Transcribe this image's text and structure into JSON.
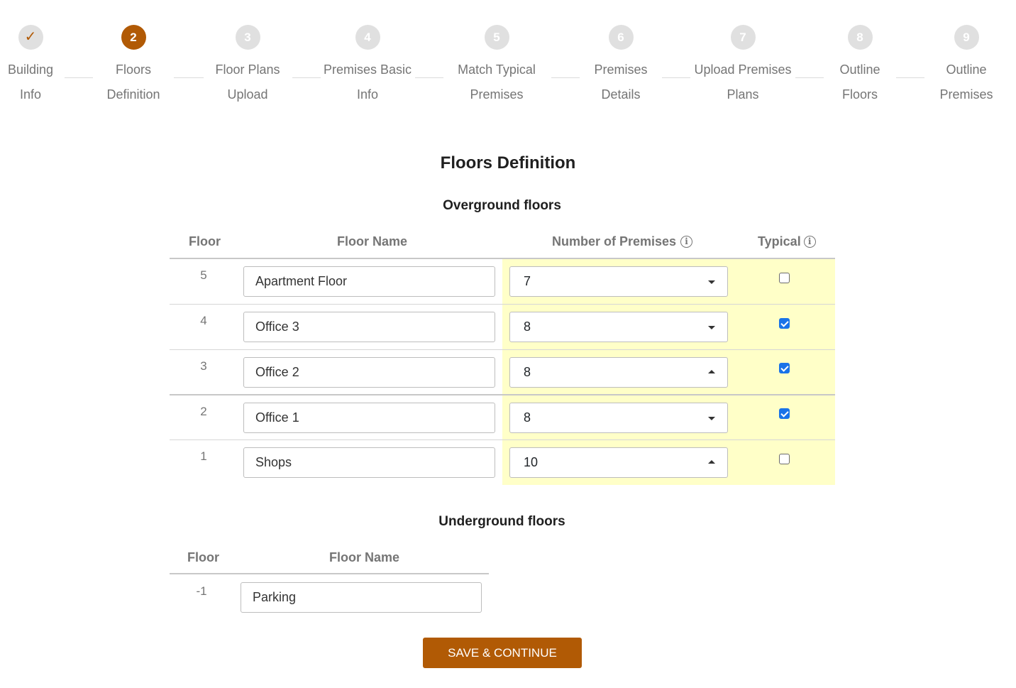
{
  "stepper": {
    "steps": [
      {
        "number": "✓",
        "line1": "Building",
        "line2": "Info",
        "state": "done"
      },
      {
        "number": "2",
        "line1": "Floors",
        "line2": "Definition",
        "state": "active"
      },
      {
        "number": "3",
        "line1": "Floor Plans",
        "line2": "Upload",
        "state": "pending"
      },
      {
        "number": "4",
        "line1": "Premises Basic",
        "line2": "Info",
        "state": "pending"
      },
      {
        "number": "5",
        "line1": "Match Typical",
        "line2": "Premises",
        "state": "pending"
      },
      {
        "number": "6",
        "line1": "Premises",
        "line2": "Details",
        "state": "pending"
      },
      {
        "number": "7",
        "line1": "Upload Premises",
        "line2": "Plans",
        "state": "pending"
      },
      {
        "number": "8",
        "line1": "Outline",
        "line2": "Floors",
        "state": "pending"
      },
      {
        "number": "9",
        "line1": "Outline",
        "line2": "Premises",
        "state": "pending"
      }
    ]
  },
  "page": {
    "title": "Floors Definition"
  },
  "overground": {
    "title": "Overground floors",
    "headers": {
      "floor": "Floor",
      "floor_name": "Floor Name",
      "premises": "Number of Premises",
      "typical": "Typical",
      "info_glyph": "i"
    },
    "rows": [
      {
        "floor": "5",
        "name": "Apartment Floor",
        "premises": "7",
        "caret": "down",
        "typical": false
      },
      {
        "floor": "4",
        "name": "Office 3",
        "premises": "8",
        "caret": "down",
        "typical": true
      },
      {
        "floor": "3",
        "name": "Office 2",
        "premises": "8",
        "caret": "up",
        "typical": true
      },
      {
        "floor": "2",
        "name": "Office 1",
        "premises": "8",
        "caret": "down",
        "typical": true
      },
      {
        "floor": "1",
        "name": "Shops",
        "premises": "10",
        "caret": "up",
        "typical": false
      }
    ]
  },
  "underground": {
    "title": "Underground floors",
    "headers": {
      "floor": "Floor",
      "floor_name": "Floor Name"
    },
    "rows": [
      {
        "floor": "-1",
        "name": "Parking"
      }
    ]
  },
  "actions": {
    "save_label": "SAVE & CONTINUE"
  },
  "colors": {
    "accent": "#b15a05",
    "highlight": "#ffffc8",
    "checkbox": "#1a73e8"
  }
}
